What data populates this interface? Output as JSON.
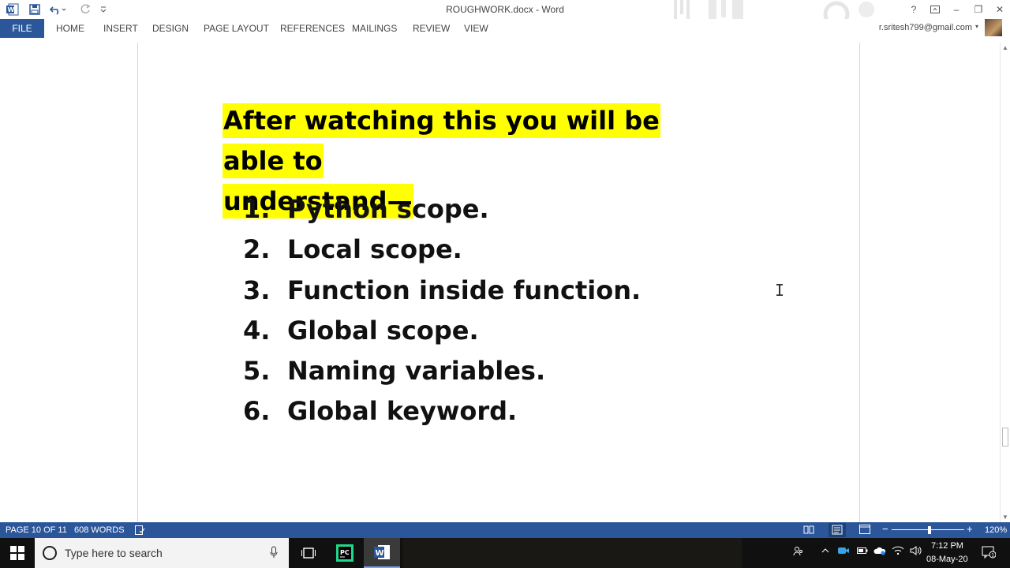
{
  "window": {
    "title": "ROUGHWORK.docx - Word",
    "help": "?",
    "minimize": "–",
    "restore": "❐",
    "close": "✕"
  },
  "ribbon": {
    "file": "FILE",
    "tabs": [
      "HOME",
      "INSERT",
      "DESIGN",
      "PAGE LAYOUT",
      "REFERENCES",
      "MAILINGS",
      "REVIEW",
      "VIEW"
    ],
    "account": "r.sritesh799@gmail.com"
  },
  "document": {
    "heading_line1": "After watching this you will be able to",
    "heading_line2": "understand—",
    "list": [
      {
        "num": "1.",
        "text": "Python scope."
      },
      {
        "num": "2.",
        "text": "Local scope."
      },
      {
        "num": "3.",
        "text": "Function inside function."
      },
      {
        "num": "4.",
        "text": "Global scope."
      },
      {
        "num": "5.",
        "text": "Naming variables."
      },
      {
        "num": "6.",
        "text": "Global keyword."
      }
    ]
  },
  "statusbar": {
    "page": "PAGE 10 OF 11",
    "words": "608 WORDS",
    "zoom_minus": "−",
    "zoom_plus": "+",
    "zoom": "120%"
  },
  "taskbar": {
    "search_placeholder": "Type here to search",
    "time": "7:12 PM",
    "date": "08-May-20"
  },
  "colors": {
    "accent": "#2b579a",
    "highlight": "#ffff00",
    "taskbar": "#101010"
  }
}
